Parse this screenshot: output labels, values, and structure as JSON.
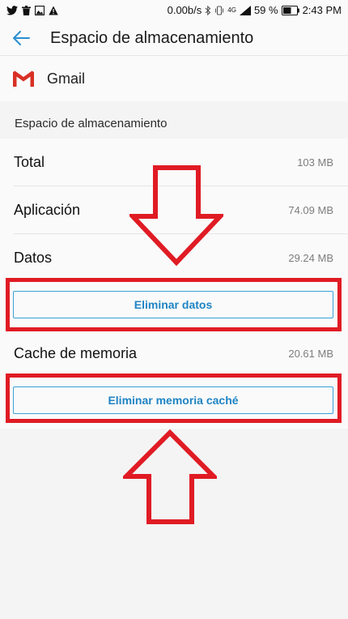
{
  "status_bar": {
    "network_speed": "0.00b/s",
    "network_type": "4G",
    "battery_percent": "59 %",
    "time": "2:43 PM",
    "icons": [
      "twitter-icon",
      "trash-icon",
      "image-icon",
      "warning-icon",
      "bluetooth-icon",
      "vibrate-icon",
      "signal-icon",
      "battery-icon"
    ]
  },
  "app_bar": {
    "title": "Espacio de almacenamiento",
    "back_icon": "arrow-back-icon"
  },
  "app_header": {
    "name": "Gmail",
    "icon": "gmail-icon"
  },
  "section": {
    "title": "Espacio de almacenamiento"
  },
  "storage": {
    "total": {
      "label": "Total",
      "value": "103 MB"
    },
    "app": {
      "label": "Aplicación",
      "value": "74.09 MB"
    },
    "data": {
      "label": "Datos",
      "value": "29.24 MB"
    },
    "cache": {
      "label": "Cache de memoria",
      "value": "20.61 MB"
    }
  },
  "actions": {
    "clear_data": "Eliminar datos",
    "clear_cache": "Eliminar memoria caché"
  },
  "colors": {
    "accent": "#1f84c4",
    "annotation": "#e01b24",
    "gmail_red": "#d93025"
  }
}
